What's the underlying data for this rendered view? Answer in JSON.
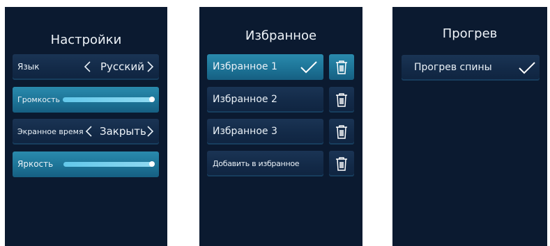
{
  "settings": {
    "title": "Настройки",
    "language": {
      "label": "Язык",
      "value": "Русский"
    },
    "volume": {
      "label": "Громкость",
      "level": 1.0
    },
    "screen_time": {
      "label": "Экранное время",
      "value": "Закрыть"
    },
    "brightness": {
      "label": "Яркость",
      "level": 1.0
    }
  },
  "favorites": {
    "title": "Избранное",
    "items": [
      {
        "label": "Избранное 1",
        "selected": true
      },
      {
        "label": "Избранное 2",
        "selected": false
      },
      {
        "label": "Избранное 3",
        "selected": false
      }
    ],
    "add_label": "Добавить в избранное"
  },
  "heating": {
    "title": "Прогрев",
    "items": [
      {
        "label": "Прогрев спины",
        "selected": true
      }
    ]
  },
  "colors": {
    "panel_bg": "#0b1a30",
    "row_bg": "#132a48",
    "row_active": "#1d7497",
    "slider_fill": "#63c8ea",
    "text": "#eaf1f7"
  },
  "icons": {
    "chevron_left": "chevron-left-icon",
    "chevron_right": "chevron-right-icon",
    "check": "check-icon",
    "trash": "trash-icon"
  }
}
